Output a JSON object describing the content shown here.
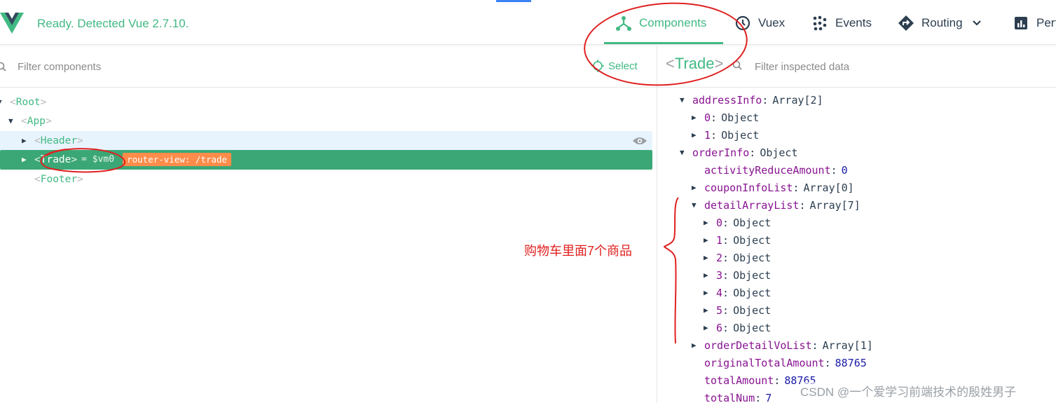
{
  "header": {
    "status": "Ready. Detected Vue 2.7.10.",
    "tabs": [
      {
        "label": "Components",
        "icon": "components-icon",
        "active": true
      },
      {
        "label": "Vuex",
        "icon": "history-icon"
      },
      {
        "label": "Events",
        "icon": "events-icon"
      },
      {
        "label": "Routing",
        "icon": "routing-icon"
      },
      {
        "label": "Perf",
        "icon": "performance-icon"
      }
    ]
  },
  "left": {
    "filter_placeholder": "Filter components",
    "select_label": "Select",
    "tree": [
      {
        "name": "Root",
        "depth": 0,
        "expanded": true
      },
      {
        "name": "App",
        "depth": 1,
        "expanded": true
      },
      {
        "name": "Header",
        "depth": 2,
        "expanded": false
      },
      {
        "name": "Trade",
        "depth": 2,
        "expanded": false,
        "selected": true,
        "ref": "= $vm0",
        "badge": "router-view: /trade"
      },
      {
        "name": "Footer",
        "depth": 2
      }
    ]
  },
  "right": {
    "selected_component": "Trade",
    "filter_placeholder": "Filter inspected data",
    "props": [
      {
        "key": "addressInfo",
        "value": "Array[2]",
        "depth": 0,
        "arrow": "down"
      },
      {
        "key": "0",
        "value": "Object",
        "depth": 1,
        "arrow": "right"
      },
      {
        "key": "1",
        "value": "Object",
        "depth": 1,
        "arrow": "right"
      },
      {
        "key": "orderInfo",
        "value": "Object",
        "depth": 0,
        "arrow": "down"
      },
      {
        "key": "activityReduceAmount",
        "value": "0",
        "depth": 1,
        "numeric": true
      },
      {
        "key": "couponInfoList",
        "value": "Array[0]",
        "depth": 1,
        "arrow": "right"
      },
      {
        "key": "detailArrayList",
        "value": "Array[7]",
        "depth": 1,
        "arrow": "down"
      },
      {
        "key": "0",
        "value": "Object",
        "depth": 2,
        "arrow": "right"
      },
      {
        "key": "1",
        "value": "Object",
        "depth": 2,
        "arrow": "right"
      },
      {
        "key": "2",
        "value": "Object",
        "depth": 2,
        "arrow": "right"
      },
      {
        "key": "3",
        "value": "Object",
        "depth": 2,
        "arrow": "right"
      },
      {
        "key": "4",
        "value": "Object",
        "depth": 2,
        "arrow": "right"
      },
      {
        "key": "5",
        "value": "Object",
        "depth": 2,
        "arrow": "right"
      },
      {
        "key": "6",
        "value": "Object",
        "depth": 2,
        "arrow": "right"
      },
      {
        "key": "orderDetailVoList",
        "value": "Array[1]",
        "depth": 1,
        "arrow": "right"
      },
      {
        "key": "originalTotalAmount",
        "value": "88765",
        "depth": 1,
        "numeric": true
      },
      {
        "key": "totalAmount",
        "value": "88765",
        "depth": 1,
        "numeric": true
      },
      {
        "key": "totalNum",
        "value": "7",
        "depth": 1,
        "numeric": true
      }
    ]
  },
  "annotation": {
    "text": "购物车里面7个商品",
    "color": "#e02020"
  },
  "watermark": "CSDN @一个爱学习前端技术的殷姓男子",
  "colors": {
    "vue_green": "#42b983",
    "selected_row": "#3ba776",
    "badge": "#ff8c4a",
    "key_purple": "#881391",
    "number_blue": "#1a1aa6"
  }
}
